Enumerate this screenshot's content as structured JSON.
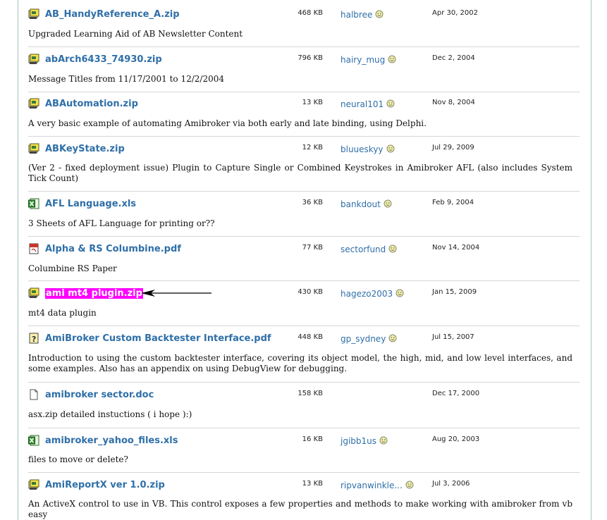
{
  "files": [
    {
      "name": "AB_HandyReference_A.zip",
      "icon": "zip-file-icon",
      "size": "468 KB",
      "user": "halbree",
      "date": "Apr 30, 2002",
      "desc": "Upgraded Learning Aid of AB Newsletter Content"
    },
    {
      "name": "abArch6433_74930.zip",
      "icon": "zip-file-icon",
      "size": "796 KB",
      "user": "hairy_mug",
      "date": "Dec 2, 2004",
      "desc": "Message Titles from 11/17/2001 to 12/2/2004"
    },
    {
      "name": "ABAutomation.zip",
      "icon": "zip-file-icon",
      "size": "13 KB",
      "user": "neural101",
      "date": "Nov 8, 2004",
      "desc": "A very basic example of automating Amibroker via both early and late binding, using Delphi."
    },
    {
      "name": "ABKeyState.zip",
      "icon": "zip-file-icon",
      "size": "12 KB",
      "user": "bluueskyy",
      "date": "Jul 29, 2009",
      "desc": "(Ver 2 - fixed deployment issue) Plugin to Capture Single or Combined Keystrokes in Amibroker AFL (also includes System Tick Count)"
    },
    {
      "name": "AFL Language.xls",
      "icon": "excel-file-icon",
      "size": "36 KB",
      "user": "bankdout",
      "date": "Feb 9, 2004",
      "desc": "3 Sheets of AFL Language for printing or??"
    },
    {
      "name": "Alpha & RS Columbine.pdf",
      "icon": "pdf-file-icon",
      "size": "77 KB",
      "user": "sectorfund",
      "date": "Nov 14, 2004",
      "desc": "Columbine RS Paper"
    },
    {
      "name": "ami mt4 plugin.zip",
      "icon": "zip-file-icon",
      "size": "430 KB",
      "user": "hagezo2003",
      "date": "Jan 15, 2009",
      "desc": "mt4 data plugin",
      "highlight": true
    },
    {
      "name": "AmiBroker Custom Backtester Interface.pdf",
      "icon": "help-file-icon",
      "size": "448 KB",
      "user": "gp_sydney",
      "date": "Jul 15, 2007",
      "desc": "Introduction to using the custom backtester interface, covering its object model, the high, mid, and low level interfaces, and some examples. Also has an appendix on using DebugView for debugging."
    },
    {
      "name": "amibroker sector.doc",
      "icon": "document-file-icon",
      "size": "158 KB",
      "user": "",
      "date": "Dec 17, 2000",
      "desc": "asx.zip detailed instuctions ( i hope ):)"
    },
    {
      "name": "amibroker_yahoo_files.xls",
      "icon": "excel-file-icon",
      "size": "16 KB",
      "user": "jgibb1us",
      "date": "Aug 20, 2003",
      "desc": "files to move or delete?"
    },
    {
      "name": "AmiReportX ver 1.0.zip",
      "icon": "zip-file-icon",
      "size": "13 KB",
      "user": "ripvanwinkle...",
      "date": "Jul 3, 2006",
      "desc": "An ActiveX control to use in VB. This control exposes a few properties and methods to make working with amibroker from vb easy"
    }
  ],
  "colors": {
    "link": "#2f6fa8",
    "highlight": "#ff00ff",
    "border": "#a8c4bf"
  }
}
